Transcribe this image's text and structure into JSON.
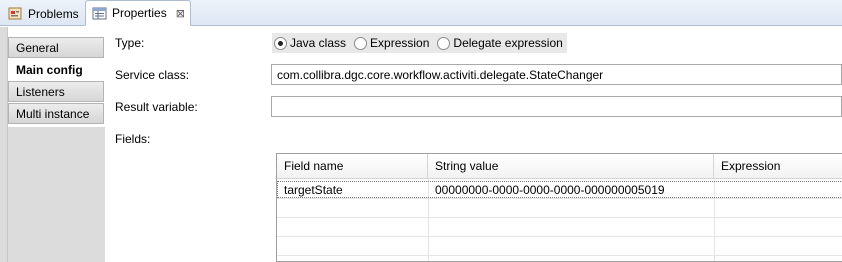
{
  "tabs": {
    "problems": {
      "label": "Problems",
      "icon": "problems-icon"
    },
    "properties": {
      "label": "Properties",
      "icon": "properties-icon",
      "close": "⊠"
    }
  },
  "sidebar": {
    "items": [
      {
        "label": "General",
        "active": false
      },
      {
        "label": "Main config",
        "active": true
      },
      {
        "label": "Listeners",
        "active": false
      },
      {
        "label": "Multi instance",
        "active": false
      }
    ]
  },
  "form": {
    "type_label": "Type:",
    "type_options": [
      {
        "label": "Java class",
        "selected": true
      },
      {
        "label": "Expression",
        "selected": false
      },
      {
        "label": "Delegate expression",
        "selected": false
      }
    ],
    "service_class_label": "Service class:",
    "service_class_value": "com.collibra.dgc.core.workflow.activiti.delegate.StateChanger",
    "result_variable_label": "Result variable:",
    "result_variable_value": "",
    "fields_label": "Fields:"
  },
  "fields_table": {
    "columns": [
      "Field name",
      "String value",
      "Expression"
    ],
    "rows": [
      [
        "targetState",
        "00000000-0000-0000-0000-000000005019",
        ""
      ]
    ]
  }
}
